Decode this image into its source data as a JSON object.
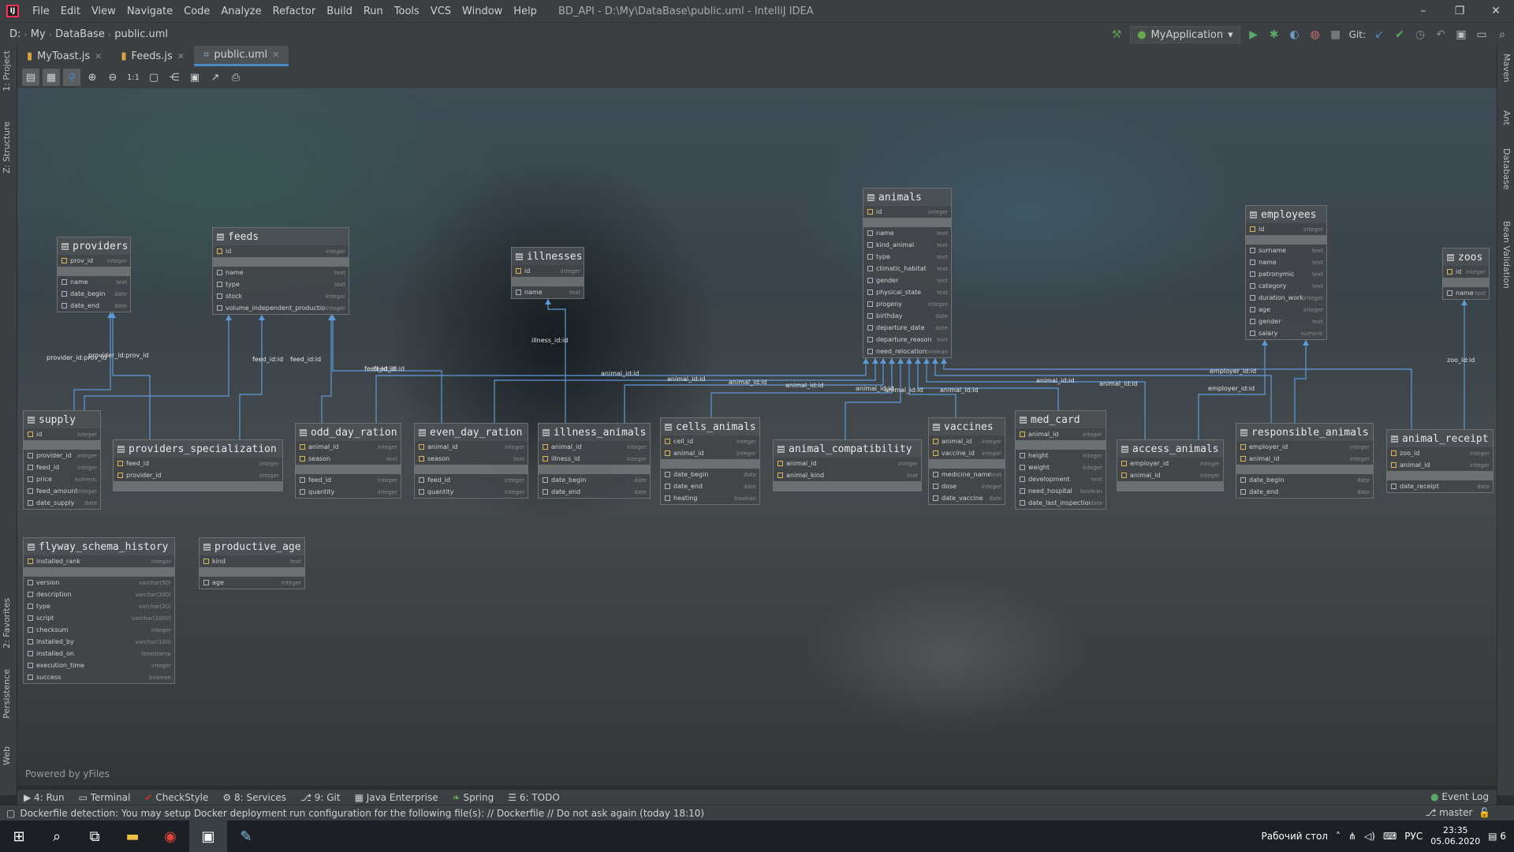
{
  "window": {
    "title": "BD_API - D:\\My\\DataBase\\public.uml - IntelliJ IDEA",
    "menu": [
      "File",
      "Edit",
      "View",
      "Navigate",
      "Code",
      "Analyze",
      "Refactor",
      "Build",
      "Run",
      "Tools",
      "VCS",
      "Window",
      "Help"
    ]
  },
  "breadcrumbs": [
    "D:",
    "My",
    "DataBase",
    "public.uml"
  ],
  "run_config": "MyApplication",
  "git_label": "Git:",
  "tabs": [
    {
      "label": "MyToast.js"
    },
    {
      "label": "Feeds.js"
    },
    {
      "label": "public.uml"
    }
  ],
  "left_panels": [
    "1: Project",
    "Z: Structure",
    "2: Favorites",
    "Persistence",
    "Web"
  ],
  "right_panels": [
    "Maven",
    "Ant",
    "Database",
    "Bean Validation"
  ],
  "diagram": {
    "powered_by": "Powered by yFiles",
    "tables": [
      {
        "id": "providers",
        "title": "providers",
        "pk": [
          [
            "prov_id",
            "integer"
          ]
        ],
        "cols": [
          [
            "name",
            "text"
          ],
          [
            "date_begin",
            "date"
          ],
          [
            "date_end",
            "date"
          ]
        ]
      },
      {
        "id": "feeds",
        "title": "feeds",
        "pk": [
          [
            "id",
            "integer"
          ]
        ],
        "cols": [
          [
            "name",
            "text"
          ],
          [
            "type",
            "text"
          ],
          [
            "stock",
            "integer"
          ],
          [
            "volume_independent_production",
            "integer"
          ]
        ]
      },
      {
        "id": "illnesses",
        "title": "illnesses",
        "pk": [
          [
            "id",
            "integer"
          ]
        ],
        "cols": [
          [
            "name",
            "text"
          ]
        ]
      },
      {
        "id": "animals",
        "title": "animals",
        "pk": [
          [
            "id",
            "integer"
          ]
        ],
        "cols": [
          [
            "name",
            "text"
          ],
          [
            "kind_animal",
            "text"
          ],
          [
            "type",
            "text"
          ],
          [
            "climatic_habitat",
            "text"
          ],
          [
            "gender",
            "text"
          ],
          [
            "physical_state",
            "text"
          ],
          [
            "progeny",
            "integer"
          ],
          [
            "birthday",
            "date"
          ],
          [
            "departure_date",
            "date"
          ],
          [
            "departure_reason",
            "text"
          ],
          [
            "need_relocation",
            "boolean"
          ]
        ]
      },
      {
        "id": "employees",
        "title": "employees",
        "pk": [
          [
            "id",
            "integer"
          ]
        ],
        "cols": [
          [
            "surname",
            "text"
          ],
          [
            "name",
            "text"
          ],
          [
            "patronymic",
            "text"
          ],
          [
            "category",
            "text"
          ],
          [
            "duration_work",
            "integer"
          ],
          [
            "age",
            "integer"
          ],
          [
            "gender",
            "text"
          ],
          [
            "salary",
            "numeric"
          ]
        ]
      },
      {
        "id": "zoos",
        "title": "zoos",
        "pk": [
          [
            "id",
            "integer"
          ]
        ],
        "cols": [
          [
            "name",
            "text"
          ]
        ]
      },
      {
        "id": "supply",
        "title": "supply",
        "pk": [
          [
            "id",
            "integer"
          ]
        ],
        "cols": [
          [
            "provider_id",
            "integer"
          ],
          [
            "feed_id",
            "integer"
          ],
          [
            "price",
            "numeric"
          ],
          [
            "feed_amount",
            "integer"
          ],
          [
            "date_supply",
            "date"
          ]
        ]
      },
      {
        "id": "providers_specialization",
        "title": "providers_specialization",
        "pk": [
          [
            "feed_id",
            "integer"
          ],
          [
            "provider_id",
            "integer"
          ]
        ],
        "cols": []
      },
      {
        "id": "odd_day_ration",
        "title": "odd_day_ration",
        "pk": [
          [
            "animal_id",
            "integer"
          ],
          [
            "season",
            "text"
          ]
        ],
        "cols": [
          [
            "feed_id",
            "integer"
          ],
          [
            "quantity",
            "integer"
          ]
        ]
      },
      {
        "id": "even_day_ration",
        "title": "even_day_ration",
        "pk": [
          [
            "animal_id",
            "integer"
          ],
          [
            "season",
            "text"
          ]
        ],
        "cols": [
          [
            "feed_id",
            "integer"
          ],
          [
            "quantity",
            "integer"
          ]
        ]
      },
      {
        "id": "illness_animals",
        "title": "illness_animals",
        "pk": [
          [
            "animal_id",
            "integer"
          ],
          [
            "illness_id",
            "integer"
          ]
        ],
        "cols": [
          [
            "date_begin",
            "date"
          ],
          [
            "date_end",
            "date"
          ]
        ]
      },
      {
        "id": "cells_animals",
        "title": "cells_animals",
        "pk": [
          [
            "cell_id",
            "integer"
          ],
          [
            "animal_id",
            "integer"
          ]
        ],
        "cols": [
          [
            "date_begin",
            "date"
          ],
          [
            "date_end",
            "date"
          ],
          [
            "heating",
            "boolean"
          ]
        ]
      },
      {
        "id": "animal_compatibility",
        "title": "animal_compatibility",
        "pk": [
          [
            "animal_id",
            "integer"
          ],
          [
            "animal_kind",
            "text"
          ]
        ],
        "cols": []
      },
      {
        "id": "vaccines",
        "title": "vaccines",
        "pk": [
          [
            "animal_id",
            "integer"
          ],
          [
            "vaccine_id",
            "integer"
          ]
        ],
        "cols": [
          [
            "medicine_name",
            "text"
          ],
          [
            "dose",
            "integer"
          ],
          [
            "date_vaccine",
            "date"
          ]
        ]
      },
      {
        "id": "med_card",
        "title": "med_card",
        "pk": [
          [
            "animal_id",
            "integer"
          ]
        ],
        "cols": [
          [
            "height",
            "integer"
          ],
          [
            "weight",
            "integer"
          ],
          [
            "development",
            "text"
          ],
          [
            "need_hospital",
            "boolean"
          ],
          [
            "date_last_inspection",
            "date"
          ]
        ]
      },
      {
        "id": "access_animals",
        "title": "access_animals",
        "pk": [
          [
            "employer_id",
            "integer"
          ],
          [
            "animal_id",
            "integer"
          ]
        ],
        "cols": []
      },
      {
        "id": "responsible_animals",
        "title": "responsible_animals",
        "pk": [
          [
            "employer_id",
            "integer"
          ],
          [
            "animal_id",
            "integer"
          ]
        ],
        "cols": [
          [
            "date_begin",
            "date"
          ],
          [
            "date_end",
            "date"
          ]
        ]
      },
      {
        "id": "animal_receipt",
        "title": "animal_receipt",
        "pk": [
          [
            "zoo_id",
            "integer"
          ],
          [
            "animal_id",
            "integer"
          ]
        ],
        "cols": [
          [
            "date_receipt",
            "date"
          ]
        ]
      },
      {
        "id": "flyway_schema_history",
        "title": "flyway_schema_history",
        "pk": [
          [
            "installed_rank",
            "integer"
          ]
        ],
        "cols": [
          [
            "version",
            "varchar(50)"
          ],
          [
            "description",
            "varchar(200)"
          ],
          [
            "type",
            "varchar(20)"
          ],
          [
            "script",
            "varchar(1000)"
          ],
          [
            "checksum",
            "integer"
          ],
          [
            "installed_by",
            "varchar(100)"
          ],
          [
            "installed_on",
            "timestamp"
          ],
          [
            "execution_time",
            "integer"
          ],
          [
            "success",
            "boolean"
          ]
        ]
      },
      {
        "id": "productive_age",
        "title": "productive_age",
        "pk": [
          [
            "kind",
            "text"
          ]
        ],
        "cols": [
          [
            "age",
            "integer"
          ]
        ]
      }
    ],
    "rel_labels": [
      "provider_id:prov_id",
      "provider_id:prov_id",
      "feed_id:id",
      "feed_id:id",
      "feed_id:id",
      "feed_id:id",
      "illness_id:id",
      "animal_id:id",
      "animal_id:id",
      "animal_id:id",
      "animal_id:id",
      "animal_id:id",
      "animal_id:id",
      "animal_id:id",
      "animal_id:id",
      "animal_id:id",
      "employer_id:id",
      "employer_id:id",
      "zoo_id:id"
    ]
  },
  "toolwindows": [
    "4: Run",
    "Terminal",
    "CheckStyle",
    "8: Services",
    "9: Git",
    "Java Enterprise",
    "Spring",
    "6: TODO"
  ],
  "event_log": "Event Log",
  "status": {
    "message": "Dockerfile detection: You may setup Docker deployment run configuration for the following file(s): // Dockerfile // Do not ask again (today 18:10)",
    "branch": "master"
  },
  "taskbar": {
    "desktop": "Рабочий стол",
    "lang": "РУС",
    "time": "23:35",
    "date": "05.06.2020",
    "notif": "6"
  }
}
